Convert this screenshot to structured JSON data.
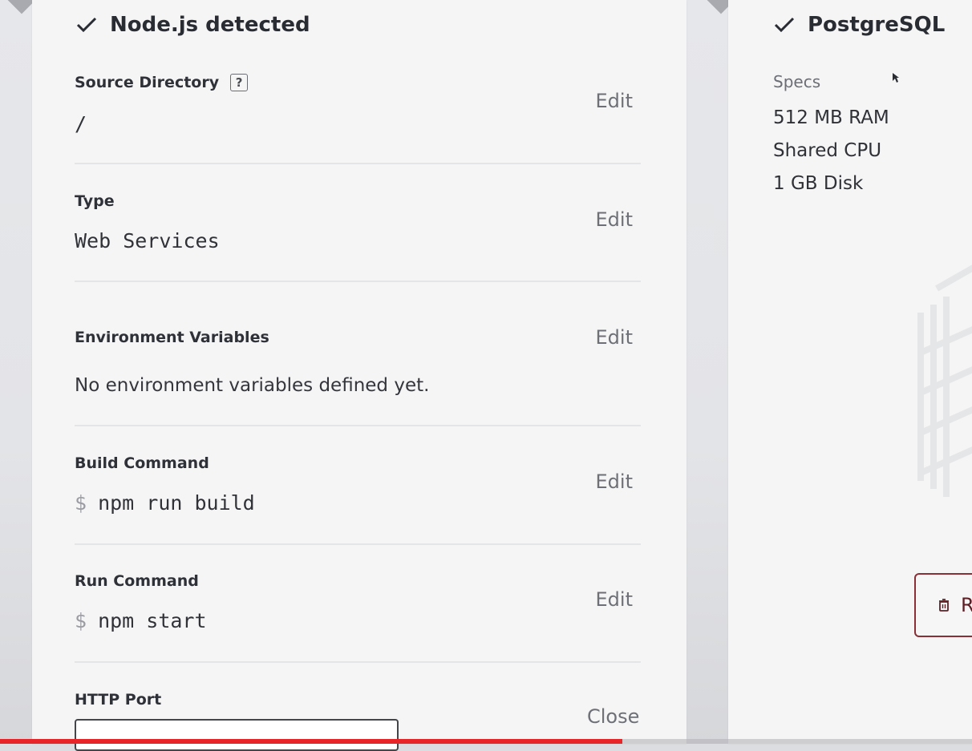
{
  "service_card": {
    "title": "Node.js detected",
    "sections": [
      {
        "label": "Source Directory",
        "help": "?",
        "value": "/",
        "edit_label": "Edit"
      },
      {
        "label": "Type",
        "value": "Web Services",
        "edit_label": "Edit"
      },
      {
        "label": "Environment Variables",
        "value": "No environment variables defined yet.",
        "edit_label": "Edit"
      },
      {
        "label": "Build Command",
        "prompt": "$",
        "value": "npm run build",
        "edit_label": "Edit"
      },
      {
        "label": "Run Command",
        "prompt": "$",
        "value": "npm start",
        "edit_label": "Edit"
      }
    ],
    "http_port": {
      "label": "HTTP Port",
      "value": "",
      "close_label": "Close"
    }
  },
  "database_card": {
    "title": "PostgreSQL",
    "specs_label": "Specs",
    "specs": [
      "512 MB RAM",
      "Shared CPU",
      "1 GB Disk"
    ],
    "remove_label": "R"
  },
  "video_progress": {
    "fraction": 0.64
  },
  "colors": {
    "accent_danger": "#8a2f36",
    "progress": "#e8262a"
  }
}
